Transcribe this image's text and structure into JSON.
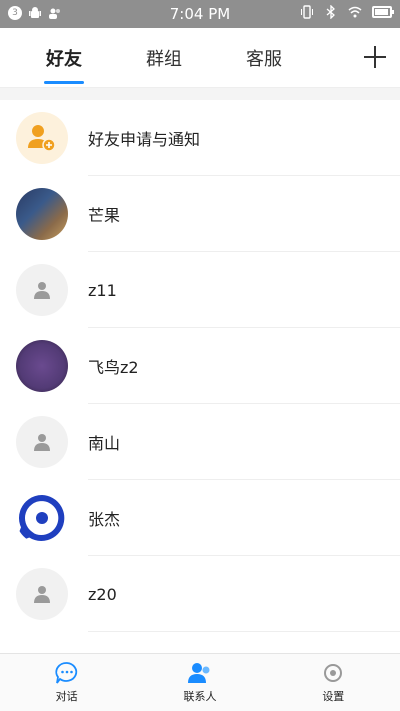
{
  "status_bar": {
    "time": "7:04 PM",
    "left_icons": [
      "badge-3-icon",
      "android-icon",
      "contacts-icon"
    ],
    "right_icons": [
      "vibrate-icon",
      "bluetooth-icon",
      "wifi-icon",
      "battery-icon"
    ],
    "badge": "3",
    "battery_level": 0.9
  },
  "tabs": [
    {
      "label": "好友",
      "active": true
    },
    {
      "label": "群组",
      "active": false
    },
    {
      "label": "客服",
      "active": false
    }
  ],
  "accent_color": "#1a8cff",
  "contacts": [
    {
      "name": "好友申请与通知",
      "avatar": "add-friend-icon"
    },
    {
      "name": "芒果",
      "avatar": "photo"
    },
    {
      "name": "z11",
      "avatar": "default-person-icon"
    },
    {
      "name": "飞鸟z2",
      "avatar": "photo"
    },
    {
      "name": "南山",
      "avatar": "default-person-icon"
    },
    {
      "name": "张杰",
      "avatar": "brand-logo"
    },
    {
      "name": "z20",
      "avatar": "default-person-icon"
    }
  ],
  "bottom_nav": [
    {
      "label": "对话",
      "icon": "chat-bubble-icon"
    },
    {
      "label": "联系人",
      "icon": "contacts-icon"
    },
    {
      "label": "设置",
      "icon": "settings-icon"
    }
  ]
}
